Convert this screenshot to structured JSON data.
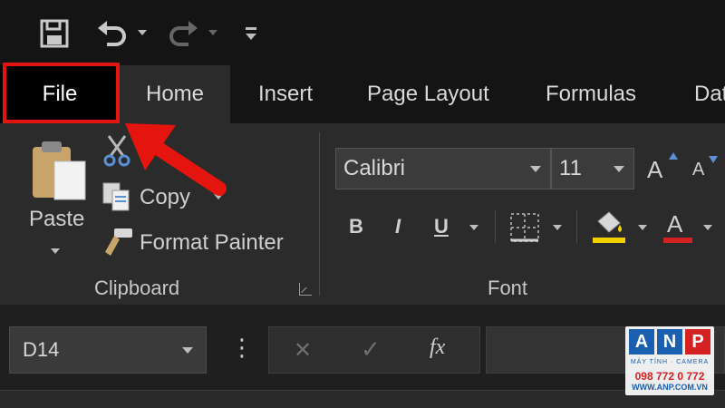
{
  "qat": {
    "save_icon": "save-icon",
    "undo_icon": "undo-icon",
    "redo_icon": "redo-icon",
    "customize_icon": "customize-qat-icon"
  },
  "tabs": {
    "file": "File",
    "home": "Home",
    "insert": "Insert",
    "page_layout": "Page Layout",
    "formulas": "Formulas",
    "data": "Dat"
  },
  "clipboard": {
    "paste": "Paste",
    "copy": "Copy",
    "format_painter": "Format Painter",
    "group_label": "Clipboard"
  },
  "font": {
    "family": "Calibri",
    "size": "11",
    "grow": "A",
    "shrink": "A",
    "bold": "B",
    "italic": "I",
    "underline": "U",
    "font_color_letter": "A",
    "group_label": "Font"
  },
  "formula_bar": {
    "name_box": "D14",
    "more": "⋮",
    "cancel": "✕",
    "enter": "✓",
    "fx": "fx"
  },
  "watermark": {
    "letters": [
      "A",
      "N",
      "P"
    ],
    "tagline": "MÁY TÍNH · CAMERA",
    "phone": "098 772 0 772",
    "url": "WWW.ANP.COM.VN"
  },
  "colors": {
    "accent_red": "#e3150e",
    "highlight_yellow": "#f2d100",
    "font_red": "#d42121"
  }
}
